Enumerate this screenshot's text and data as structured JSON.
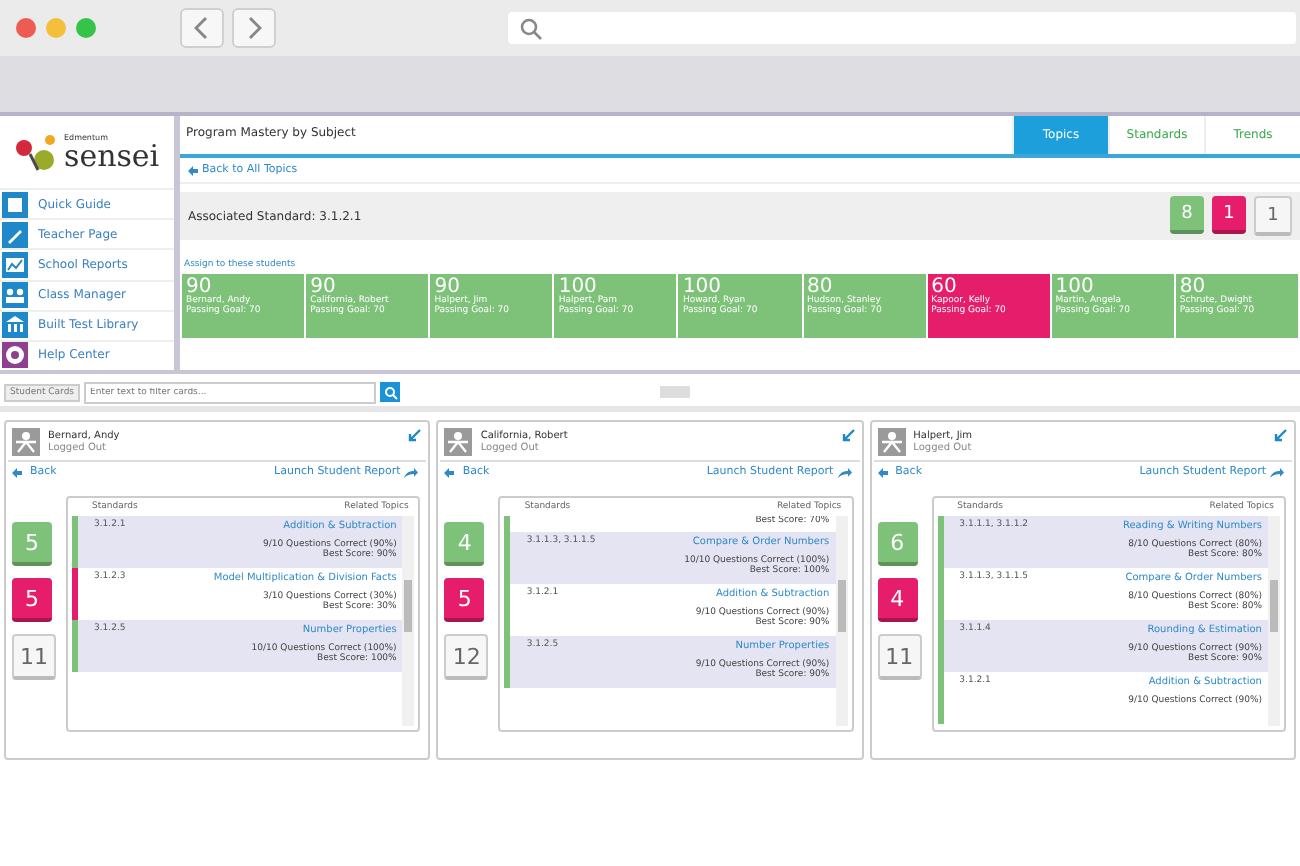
{
  "sidebar": {
    "logo_small": "Edmentum",
    "logo": "sensei",
    "items": [
      {
        "label": "Quick Guide"
      },
      {
        "label": "Teacher Page"
      },
      {
        "label": "School Reports"
      },
      {
        "label": "Class Manager"
      },
      {
        "label": "Built Test Library"
      },
      {
        "label": "Help Center"
      }
    ]
  },
  "header": {
    "title": "Program Mastery by Subject",
    "tabs": [
      {
        "label": "Topics",
        "selected": true
      },
      {
        "label": "Standards",
        "selected": false
      },
      {
        "label": "Trends",
        "selected": false
      }
    ]
  },
  "back_link": "Back to All Topics",
  "standard_bar": {
    "label": "Associated Standard: 3.1.2.1",
    "counts": [
      {
        "value": "8",
        "kind": "passed"
      },
      {
        "value": "1",
        "kind": "failed"
      },
      {
        "value": "1",
        "kind": "none"
      }
    ]
  },
  "assign_label": "Assign to these students",
  "students": [
    {
      "score": "90",
      "name": "Bernard, Andy",
      "goal": "Passing Goal: 70",
      "passed": true
    },
    {
      "score": "90",
      "name": "California, Robert",
      "goal": "Passing Goal: 70",
      "passed": true
    },
    {
      "score": "90",
      "name": "Halpert, Jim",
      "goal": "Passing Goal: 70",
      "passed": true
    },
    {
      "score": "100",
      "name": "Halpert, Pam",
      "goal": "Passing Goal: 70",
      "passed": true
    },
    {
      "score": "100",
      "name": "Howard, Ryan",
      "goal": "Passing Goal: 70",
      "passed": true
    },
    {
      "score": "80",
      "name": "Hudson, Stanley",
      "goal": "Passing Goal: 70",
      "passed": true
    },
    {
      "score": "60",
      "name": "Kapoor, Kelly",
      "goal": "Passing Goal: 70",
      "passed": false
    },
    {
      "score": "100",
      "name": "Martin, Angela",
      "goal": "Passing Goal: 70",
      "passed": true
    },
    {
      "score": "80",
      "name": "Schrute, Dwight",
      "goal": "Passing Goal: 70",
      "passed": true
    }
  ],
  "filter": {
    "label": "Student Cards",
    "placeholder": "Enter text to filter cards..."
  },
  "cards": [
    {
      "name": "Bernard, Andy",
      "status": "Logged Out",
      "back": "Back",
      "report": "Launch Student Report",
      "counts": [
        {
          "value": "5",
          "kind": "passed"
        },
        {
          "value": "5",
          "kind": "failed"
        },
        {
          "value": "11",
          "kind": "none"
        }
      ],
      "col_standards": "Standards",
      "col_topics": "Related Topics",
      "rows": [
        {
          "standard": "3.1.2.1",
          "topic": "Addition & Subtraction",
          "correct": "9/10 Questions Correct (90%)",
          "best": "Best Score: 90%",
          "passed": true
        },
        {
          "standard": "3.1.2.3",
          "topic": "Model Multiplication & Division Facts",
          "correct": "3/10 Questions Correct (30%)",
          "best": "Best Score: 30%",
          "passed": false
        },
        {
          "standard": "3.1.2.5",
          "topic": "Number Properties",
          "correct": "10/10 Questions Correct (100%)",
          "best": "Best Score: 100%",
          "passed": true
        }
      ]
    },
    {
      "name": "California, Robert",
      "status": "Logged Out",
      "back": "Back",
      "report": "Launch Student Report",
      "counts": [
        {
          "value": "4",
          "kind": "passed"
        },
        {
          "value": "5",
          "kind": "failed"
        },
        {
          "value": "12",
          "kind": "none"
        }
      ],
      "col_standards": "Standards",
      "col_topics": "Related Topics",
      "tail": "Best Score: 70%",
      "rows": [
        {
          "standard": "3.1.1.3, 3.1.1.5",
          "topic": "Compare & Order Numbers",
          "correct": "10/10 Questions Correct (100%)",
          "best": "Best Score: 100%",
          "passed": true
        },
        {
          "standard": "3.1.2.1",
          "topic": "Addition & Subtraction",
          "correct": "9/10 Questions Correct (90%)",
          "best": "Best Score: 90%",
          "passed": true
        },
        {
          "standard": "3.1.2.5",
          "topic": "Number Properties",
          "correct": "9/10 Questions Correct (90%)",
          "best": "Best Score: 90%",
          "passed": true
        }
      ]
    },
    {
      "name": "Halpert, Jim",
      "status": "Logged Out",
      "back": "Back",
      "report": "Launch Student Report",
      "counts": [
        {
          "value": "6",
          "kind": "passed"
        },
        {
          "value": "4",
          "kind": "failed"
        },
        {
          "value": "11",
          "kind": "none"
        }
      ],
      "col_standards": "Standards",
      "col_topics": "Related Topics",
      "rows": [
        {
          "standard": "3.1.1.1, 3.1.1.2",
          "topic": "Reading & Writing Numbers",
          "correct": "8/10 Questions Correct (80%)",
          "best": "Best Score: 80%",
          "passed": true
        },
        {
          "standard": "3.1.1.3, 3.1.1.5",
          "topic": "Compare & Order Numbers",
          "correct": "8/10 Questions Correct (80%)",
          "best": "Best Score: 80%",
          "passed": true
        },
        {
          "standard": "3.1.1.4",
          "topic": "Rounding & Estimation",
          "correct": "9/10 Questions Correct (90%)",
          "best": "Best Score: 90%",
          "passed": true
        },
        {
          "standard": "3.1.2.1",
          "topic": "Addition & Subtraction",
          "correct": "9/10 Questions Correct (90%)",
          "passed": true
        }
      ]
    }
  ]
}
